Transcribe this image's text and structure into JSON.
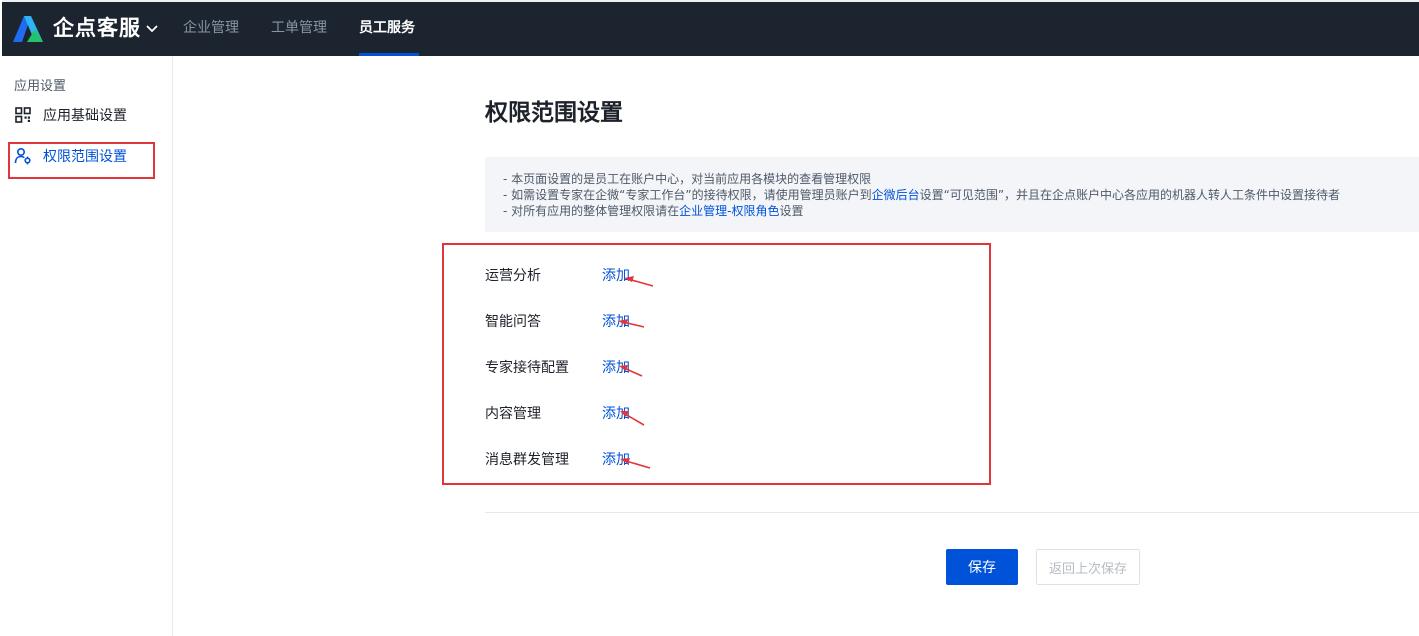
{
  "header": {
    "brand": "企点客服",
    "nav": [
      {
        "label": "企业管理",
        "active": false
      },
      {
        "label": "工单管理",
        "active": false
      },
      {
        "label": "员工服务",
        "active": true
      }
    ],
    "icons": {
      "logo": "qidian-logo-icon",
      "caret": "chevron-down-icon"
    }
  },
  "sidebar": {
    "group_label": "应用设置",
    "items": [
      {
        "label": "应用基础设置",
        "icon": "grid-icon",
        "active": false
      },
      {
        "label": "权限范围设置",
        "icon": "user-settings-icon",
        "active": true
      }
    ]
  },
  "main": {
    "title": "权限范围设置",
    "notice": {
      "line1": "- 本页面设置的是员工在账户中心，对当前应用各模块的查看管理权限",
      "line2_prefix": "- 如需设置专家在企微“专家工作台”的接待权限，请使用管理员账户到",
      "line2_link": "企微后台",
      "line2_suffix": "设置“可见范围”，并且在企点账户中心各应用的机器人转人工条件中设置接待者",
      "line3_prefix": "- 对所有应用的整体管理权限请在",
      "line3_link": "企业管理-权限角色",
      "line3_suffix": "设置"
    },
    "permissions": [
      {
        "label": "运营分析",
        "action": "添加"
      },
      {
        "label": "智能问答",
        "action": "添加"
      },
      {
        "label": "专家接待配置",
        "action": "添加"
      },
      {
        "label": "内容管理",
        "action": "添加"
      },
      {
        "label": "消息群发管理",
        "action": "添加"
      }
    ],
    "buttons": {
      "save": "保存",
      "revert": "返回上次保存"
    }
  },
  "colors": {
    "topbar": "#1c2430",
    "accent": "#0052d9",
    "annotation": "#e0363a",
    "notice_bg": "#f3f5f8"
  }
}
